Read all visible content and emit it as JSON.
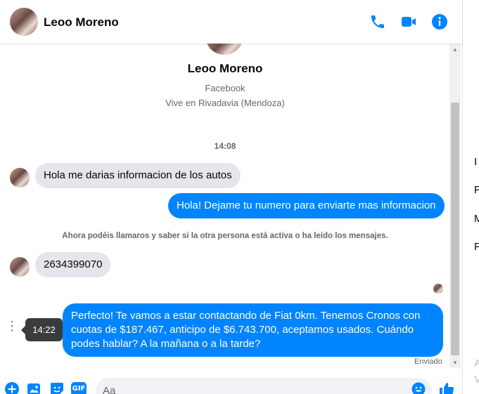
{
  "colors": {
    "accent": "#0084ff",
    "incoming_bubble": "#e4e6eb",
    "muted_text": "#65676b"
  },
  "header": {
    "contact_name": "Leoo Moreno",
    "icons": [
      "phone-icon",
      "video-call-icon",
      "info-icon"
    ]
  },
  "profile": {
    "name": "Leoo Moreno",
    "platform": "Facebook",
    "location": "Vive en Rivadavia (Mendoza)"
  },
  "conversation": {
    "timestamp": "14:08",
    "notice": "Ahora podéis llamaros y saber si la otra persona está activa o ha leído los mensajes.",
    "messages": [
      {
        "direction": "incoming",
        "text": "Hola me darias informacion de los autos"
      },
      {
        "direction": "outgoing",
        "text": "Hola! Dejame tu numero para enviarte mas informacion"
      },
      {
        "direction": "incoming",
        "text": "2634399070"
      },
      {
        "direction": "outgoing",
        "text": "Perfecto! Te vamos a estar contactando de Fiat 0km. Tenemos Cronos con cuotas de $187.467, anticipo de $6.743.700, aceptamos usados. Cuándo podes hablar? A la mañana o a la tarde?"
      }
    ],
    "hover_time": "14:22",
    "status": "Enviado",
    "more_dots": "⋮"
  },
  "scrollbar": {
    "up": "▲",
    "down": "▼"
  },
  "composer": {
    "placeholder": "Aa",
    "gif_label": "GIF",
    "icons": [
      "plus-icon",
      "photo-icon",
      "sticker-icon",
      "gif-icon",
      "emoji-icon",
      "like-icon"
    ]
  },
  "right_panel": {
    "letters": [
      "I",
      "P",
      "M",
      "P"
    ],
    "faded_letters": [
      "A",
      "V"
    ]
  }
}
